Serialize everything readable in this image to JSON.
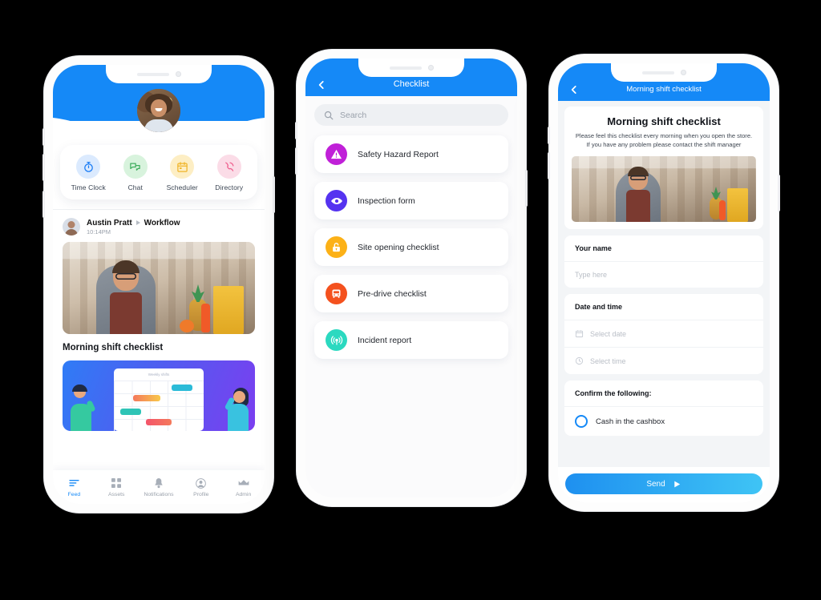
{
  "colors": {
    "header_blue": "#1589f7",
    "accent_blue": "#1589f7",
    "send_gradient_from": "#1e90f0",
    "send_gradient_to": "#3fc4f5",
    "hazard_magenta": "#c020d8",
    "inspection_indigo": "#5533f0",
    "site_amber": "#fcb117",
    "predrive_orange": "#f4511e",
    "incident_teal": "#2bd9c0"
  },
  "phone1": {
    "quick_actions": [
      {
        "label": "Time Clock",
        "icon": "stopwatch-icon",
        "bg": "#dbeafe",
        "fg": "#1d7ef5"
      },
      {
        "label": "Chat",
        "icon": "chat-bubbles-icon",
        "bg": "#d8f3dd",
        "fg": "#3fae5e"
      },
      {
        "label": "Scheduler",
        "icon": "calendar-icon",
        "bg": "#fdeec4",
        "fg": "#f0b429"
      },
      {
        "label": "Directory",
        "icon": "phone-icon",
        "bg": "#fbdce7",
        "fg": "#ef5c8c"
      }
    ],
    "post": {
      "author": "Austin Pratt",
      "channel": "Workflow",
      "time": "10:14PM",
      "caption": "Morning shift checklist"
    },
    "promo": {
      "board_title": "Weekly shifts"
    },
    "tabs": [
      {
        "label": "Feed",
        "icon": "feed-icon",
        "active": true
      },
      {
        "label": "Assets",
        "icon": "grid-icon",
        "active": false
      },
      {
        "label": "Notifications",
        "icon": "bell-icon",
        "active": false
      },
      {
        "label": "Profile",
        "icon": "person-icon",
        "active": false
      },
      {
        "label": "Admin",
        "icon": "crown-icon",
        "active": false
      }
    ]
  },
  "phone2": {
    "title": "Checklist",
    "back_icon": "chevron-left-icon",
    "search_placeholder": "Search",
    "items": [
      {
        "label": "Safety Hazard Report",
        "icon": "warning-triangle-icon",
        "color": "#c020d8"
      },
      {
        "label": "Inspection form",
        "icon": "eye-icon",
        "color": "#5533f0"
      },
      {
        "label": "Site opening checklist",
        "icon": "padlock-icon",
        "color": "#fcb117"
      },
      {
        "label": "Pre-drive checklist",
        "icon": "bus-icon",
        "color": "#f4511e"
      },
      {
        "label": "Incident report",
        "icon": "broadcast-icon",
        "color": "#2bd9c0"
      }
    ]
  },
  "phone3": {
    "header_title": "Morning shift checklist",
    "back_icon": "chevron-left-icon",
    "form_title": "Morning shift checklist",
    "form_desc": "Please feel this checklist every morning when you open the store. If you have any problem please contact the shift manager",
    "fields": [
      {
        "label": "Your name",
        "placeholder": "Type here",
        "icon": null
      },
      {
        "label": "Date and time",
        "placeholder": "Select date",
        "icon": "calendar-icon"
      },
      {
        "label": null,
        "placeholder": "Select time",
        "icon": "clock-icon"
      }
    ],
    "confirm_label": "Confirm the following:",
    "confirm_items": [
      {
        "label": "Cash in the cashbox",
        "checked": false
      }
    ],
    "send_label": "Send",
    "send_icon": "play-arrow-icon"
  }
}
